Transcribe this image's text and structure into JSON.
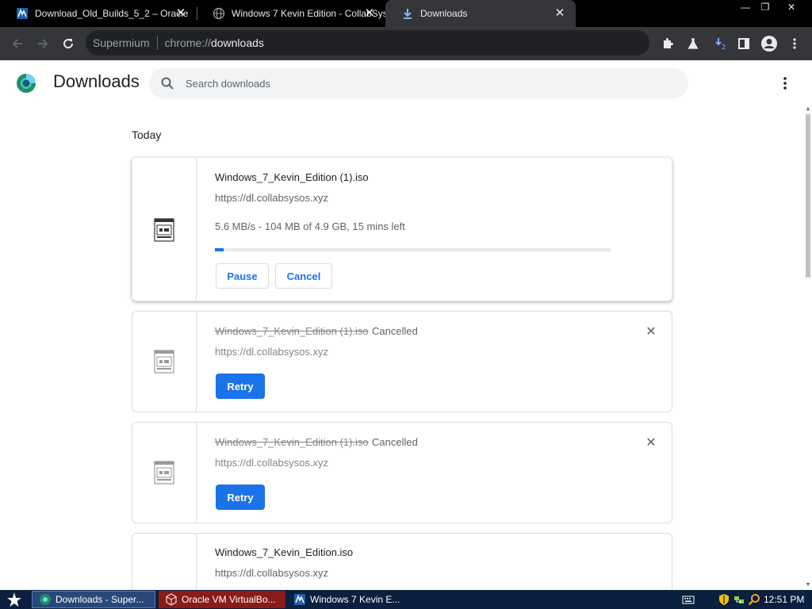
{
  "tabs": [
    {
      "title": "Download_Old_Builds_5_2 – Oracle",
      "favicon": "virtualbox-icon"
    },
    {
      "title": "Windows 7 Kevin Edition - CollabSys",
      "favicon": "globe-icon"
    },
    {
      "title": "Downloads",
      "favicon": "download-icon"
    }
  ],
  "window_controls": {
    "minimize": "—",
    "restore": "❐",
    "close": "✕"
  },
  "omnibox": {
    "scheme_label": "Supermium",
    "url_prefix": "chrome://",
    "url_host": "downloads"
  },
  "header": {
    "title": "Downloads",
    "search_placeholder": "Search downloads"
  },
  "section": {
    "label": "Today"
  },
  "downloads": [
    {
      "filename": "Windows_7_Kevin_Edition (1).iso",
      "url": "https://dl.collabsysos.xyz",
      "progress_text": "5.6 MB/s - 104 MB of 4.9 GB, 15 mins left",
      "progress_fraction": 0.021,
      "buttons": [
        "Pause",
        "Cancel"
      ]
    },
    {
      "filename": "Windows_7_Kevin_Edition (1).iso",
      "status": "Cancelled",
      "url": "https://dl.collabsysos.xyz",
      "button": "Retry"
    },
    {
      "filename": "Windows_7_Kevin_Edition (1).iso",
      "status": "Cancelled",
      "url": "https://dl.collabsysos.xyz",
      "button": "Retry"
    },
    {
      "filename": "Windows_7_Kevin_Edition.iso",
      "url": "https://dl.collabsysos.xyz"
    }
  ],
  "taskbar": {
    "tasks": [
      {
        "label": "Downloads - Super..."
      },
      {
        "label": "Oracle VM VirtualBo..."
      },
      {
        "label": "Windows 7 Kevin E..."
      }
    ],
    "clock": "12:51 PM"
  },
  "colors": {
    "accent": "#1a73e8",
    "tabstrip": "#000000",
    "toolbar": "#35363a",
    "taskbar": "#0b1f3e"
  }
}
